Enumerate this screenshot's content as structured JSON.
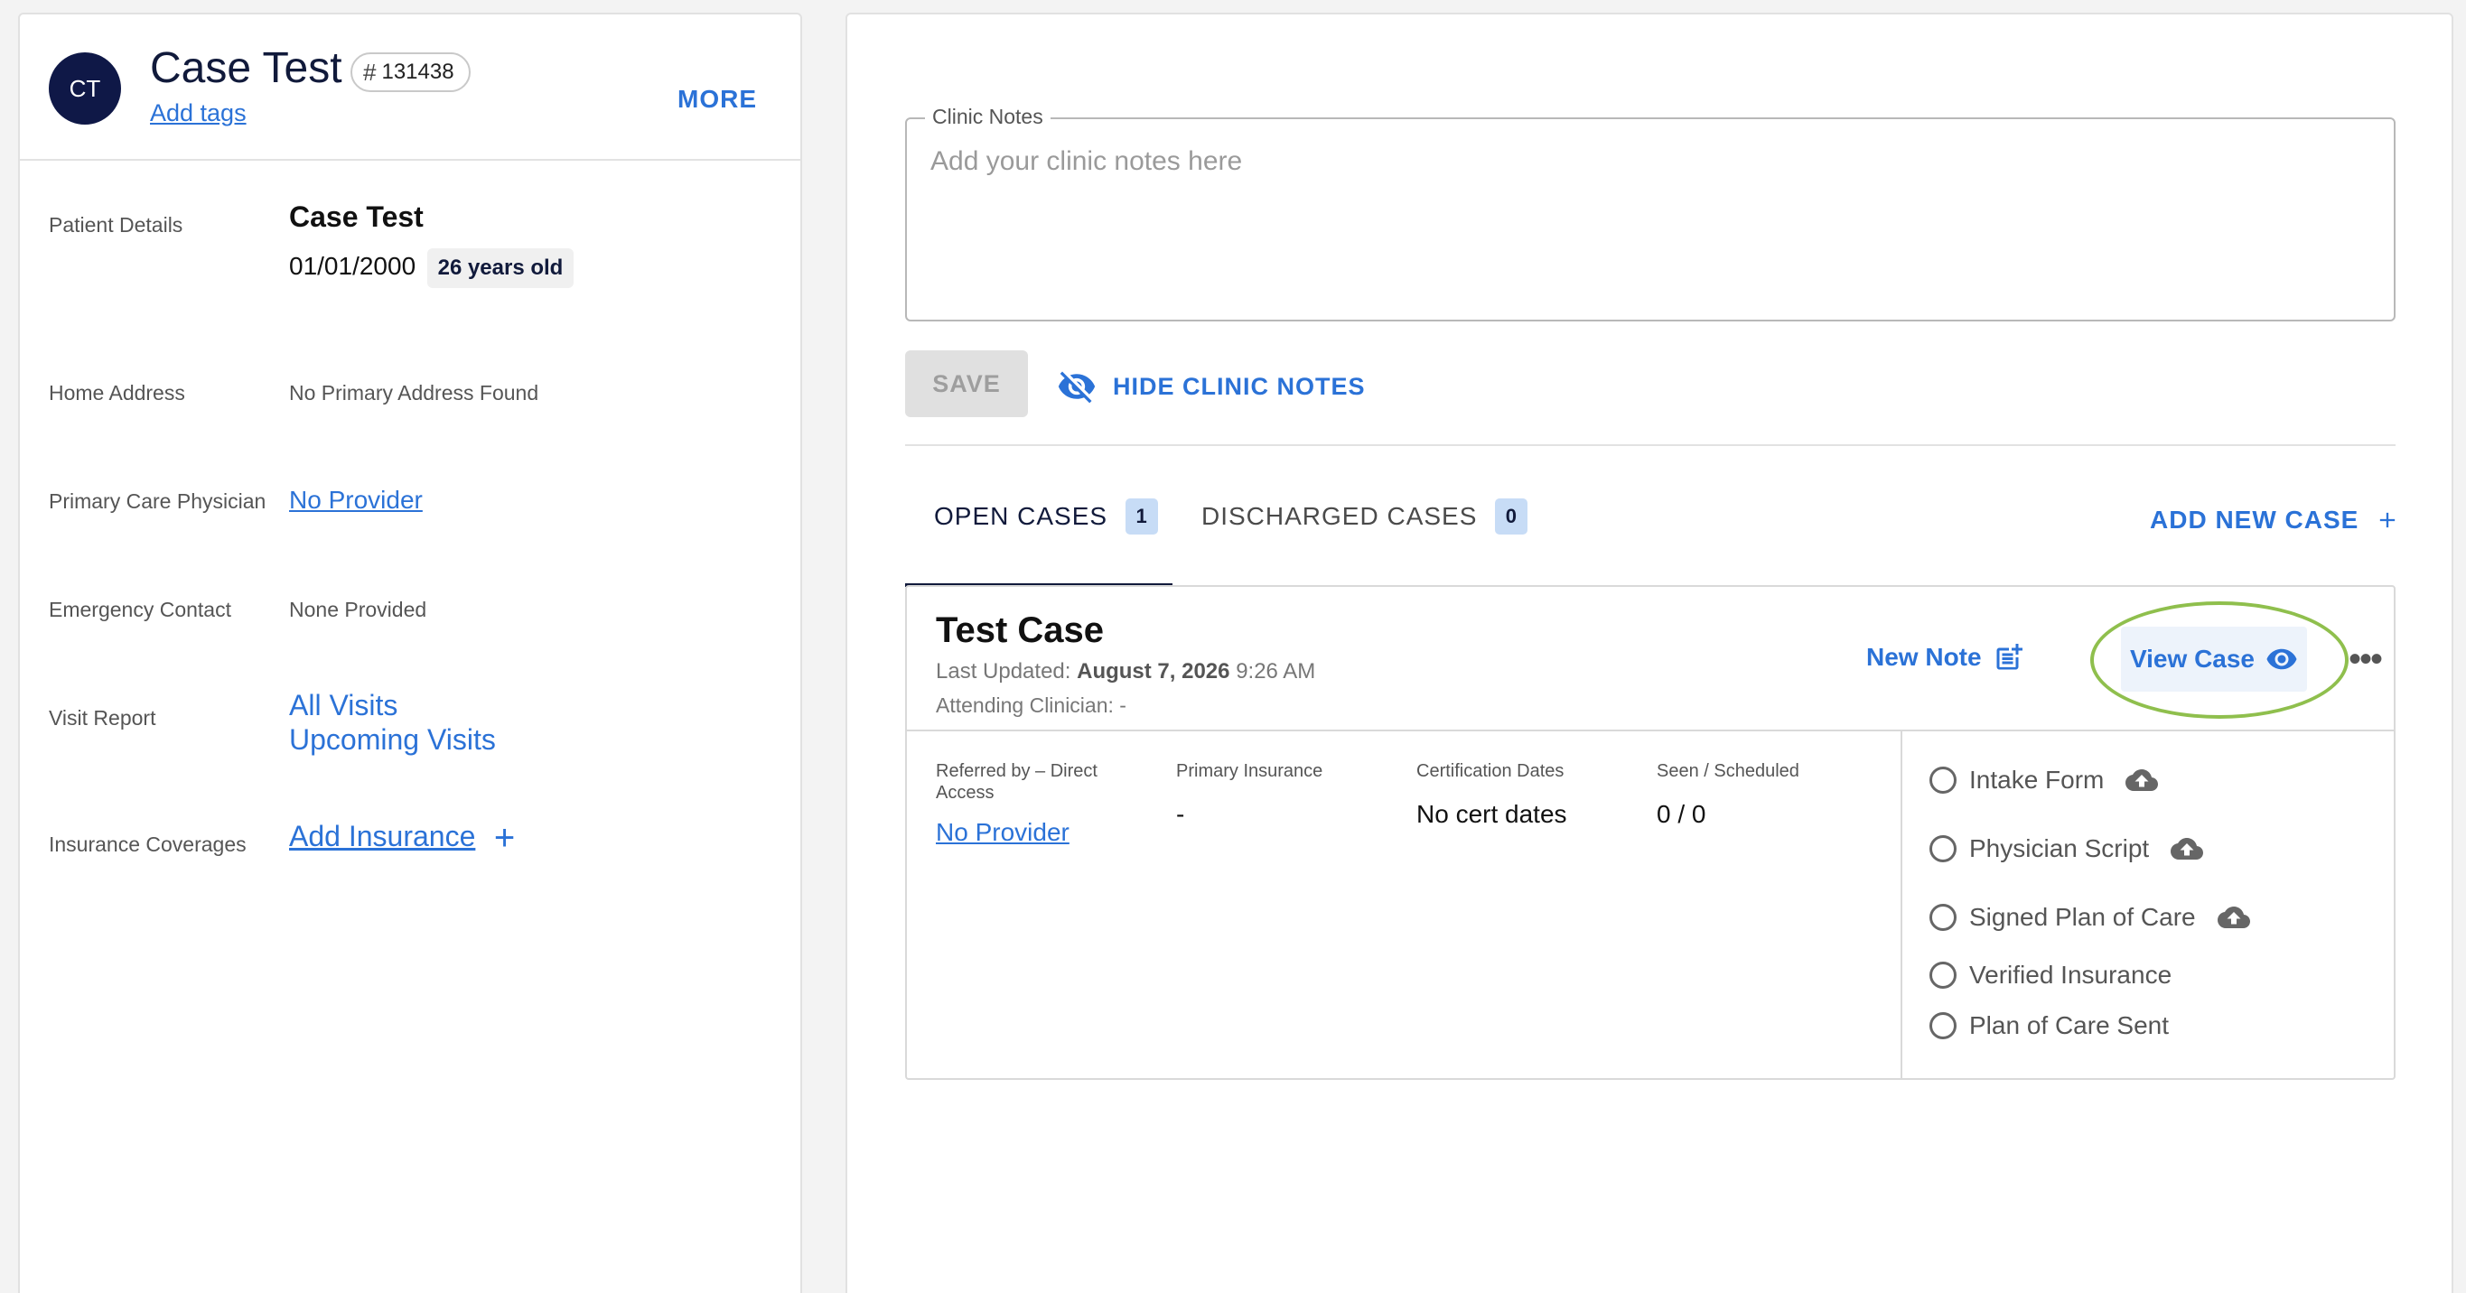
{
  "header": {
    "initials": "CT",
    "patient_name": "Case Test",
    "patient_id": "131438",
    "add_tags": "Add tags",
    "more": "MORE"
  },
  "details": {
    "patient_details_label": "Patient Details",
    "patient_name": "Case Test",
    "dob": "01/01/2000",
    "age": "26 years old",
    "home_address_label": "Home Address",
    "home_address": "No Primary Address Found",
    "pcp_label": "Primary Care Physician",
    "pcp_value": "No Provider",
    "emergency_label": "Emergency Contact",
    "emergency_value": "None Provided",
    "visit_report_label": "Visit Report",
    "all_visits": "All Visits",
    "upcoming_visits": "Upcoming Visits",
    "insurance_label": "Insurance Coverages",
    "add_insurance": "Add Insurance"
  },
  "notes": {
    "legend": "Clinic Notes",
    "placeholder": "Add your clinic notes here",
    "save": "SAVE",
    "hide": "HIDE CLINIC NOTES"
  },
  "tabs": [
    {
      "label": "OPEN CASES",
      "count": "1"
    },
    {
      "label": "DISCHARGED CASES",
      "count": "0"
    }
  ],
  "add_case": "ADD NEW CASE",
  "case": {
    "title": "Test Case",
    "updated_prefix": "Last Updated:",
    "updated_date": "August 7, 2026",
    "updated_time": "9:26 AM",
    "clinician": "Attending Clinician: -",
    "new_note": "New Note",
    "view_case": "View Case",
    "referred_label": "Referred by – Direct Access",
    "referred_value": "No Provider",
    "insurance_label": "Primary Insurance",
    "insurance_value": "-",
    "cert_label": "Certification Dates",
    "cert_value": "No cert dates",
    "seen_label": "Seen / Scheduled",
    "seen_value": "0 / 0",
    "checklist": [
      {
        "label": "Intake Form",
        "upload": true
      },
      {
        "label": "Physician Script",
        "upload": true
      },
      {
        "label": "Signed Plan of Care",
        "upload": true
      },
      {
        "label": "Verified Insurance",
        "upload": false
      },
      {
        "label": "Plan of Care Sent",
        "upload": false
      }
    ]
  },
  "colors": {
    "accent": "#2b72d7",
    "navy": "#111a3b",
    "highlight": "#8fbf4d"
  },
  "icons": [
    "hash-icon",
    "plus-icon",
    "eye-off-icon",
    "note-add-icon",
    "eye-icon",
    "more-horiz-icon",
    "cloud-upload-icon"
  ]
}
